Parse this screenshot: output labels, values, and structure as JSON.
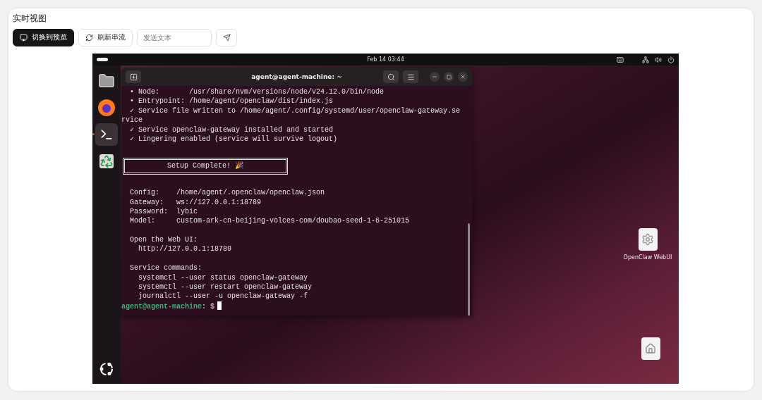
{
  "panel": {
    "title": "实时视图"
  },
  "toolbar": {
    "buttons": [
      {
        "kind": "primary",
        "label": "切换到预览"
      },
      {
        "kind": "default",
        "label": "刷新串流"
      }
    ],
    "message_field": {
      "placeholder": "发送文本"
    }
  },
  "desktop": {
    "top_bar": {
      "clock": "Feb 14  03:44"
    },
    "dock": [
      {
        "kind": "files",
        "selected": false
      },
      {
        "kind": "browser",
        "selected": false
      },
      {
        "kind": "terminal",
        "selected": true
      },
      {
        "kind": "trash",
        "selected": false
      }
    ],
    "terminal": {
      "title": "agent@agent-machine: ~",
      "lines": [
        {
          "kind": "text",
          "text": "  • Node:       /usr/share/nvm/versions/node/v24.12.0/bin/node"
        },
        {
          "kind": "text",
          "text": "  • Entrypoint: /home/agent/openclaw/dist/index.js"
        },
        {
          "kind": "text",
          "text": "  ✓ Service file written to /home/agent/.config/systemd/user/openclaw-gateway.se"
        },
        {
          "kind": "text",
          "text": "rvice"
        },
        {
          "kind": "text",
          "text": "  ✓ Service openclaw-gateway installed and started"
        },
        {
          "kind": "text",
          "text": "  ✓ Lingering enabled (service will survive logout)"
        },
        {
          "kind": "gap"
        },
        {
          "kind": "banner",
          "text": "Setup Complete! 🎉"
        },
        {
          "kind": "gap"
        },
        {
          "kind": "text",
          "text": "  Config:    /home/agent/.openclaw/openclaw.json"
        },
        {
          "kind": "text",
          "text": "  Gateway:   ws://127.0.0.1:18789"
        },
        {
          "kind": "text",
          "text": "  Password:  lybic"
        },
        {
          "kind": "text",
          "text": "  Model:     custom-ark-cn-beijing-volces-com/doubao-seed-1-6-251015"
        },
        {
          "kind": "gap"
        },
        {
          "kind": "text",
          "text": "  Open the Web UI:"
        },
        {
          "kind": "text",
          "text": "    http://127.0.0.1:18789"
        },
        {
          "kind": "gap"
        },
        {
          "kind": "text",
          "text": "  Service commands:"
        },
        {
          "kind": "text",
          "text": "    systemctl --user status openclaw-gateway"
        },
        {
          "kind": "text",
          "text": "    systemctl --user restart openclaw-gateway"
        },
        {
          "kind": "text",
          "text": "    journalctl --user -u openclaw-gateway -f"
        },
        {
          "kind": "prompt",
          "user": "agent@agent-machine",
          "text": ": $"
        }
      ]
    },
    "icons": [
      {
        "kind": "gear",
        "label": "OpenClaw WebUI"
      },
      {
        "kind": "home"
      }
    ]
  }
}
